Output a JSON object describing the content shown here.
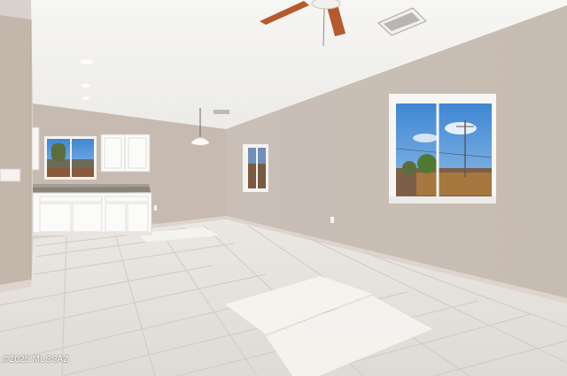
{
  "photo": {
    "watermark": "©2025 MLSSAZ",
    "colors": {
      "ceiling": "#f4f3f1",
      "wall_right": "#cdc3bb",
      "wall_back": "#c8bdb5",
      "wall_left": "#c4b8ad",
      "floor": "#e6e3de",
      "cabinet": "#fbfbfa",
      "counter": "#8a8378",
      "sky": "#4f93d8",
      "fan_blade": "#b55a2c"
    }
  }
}
